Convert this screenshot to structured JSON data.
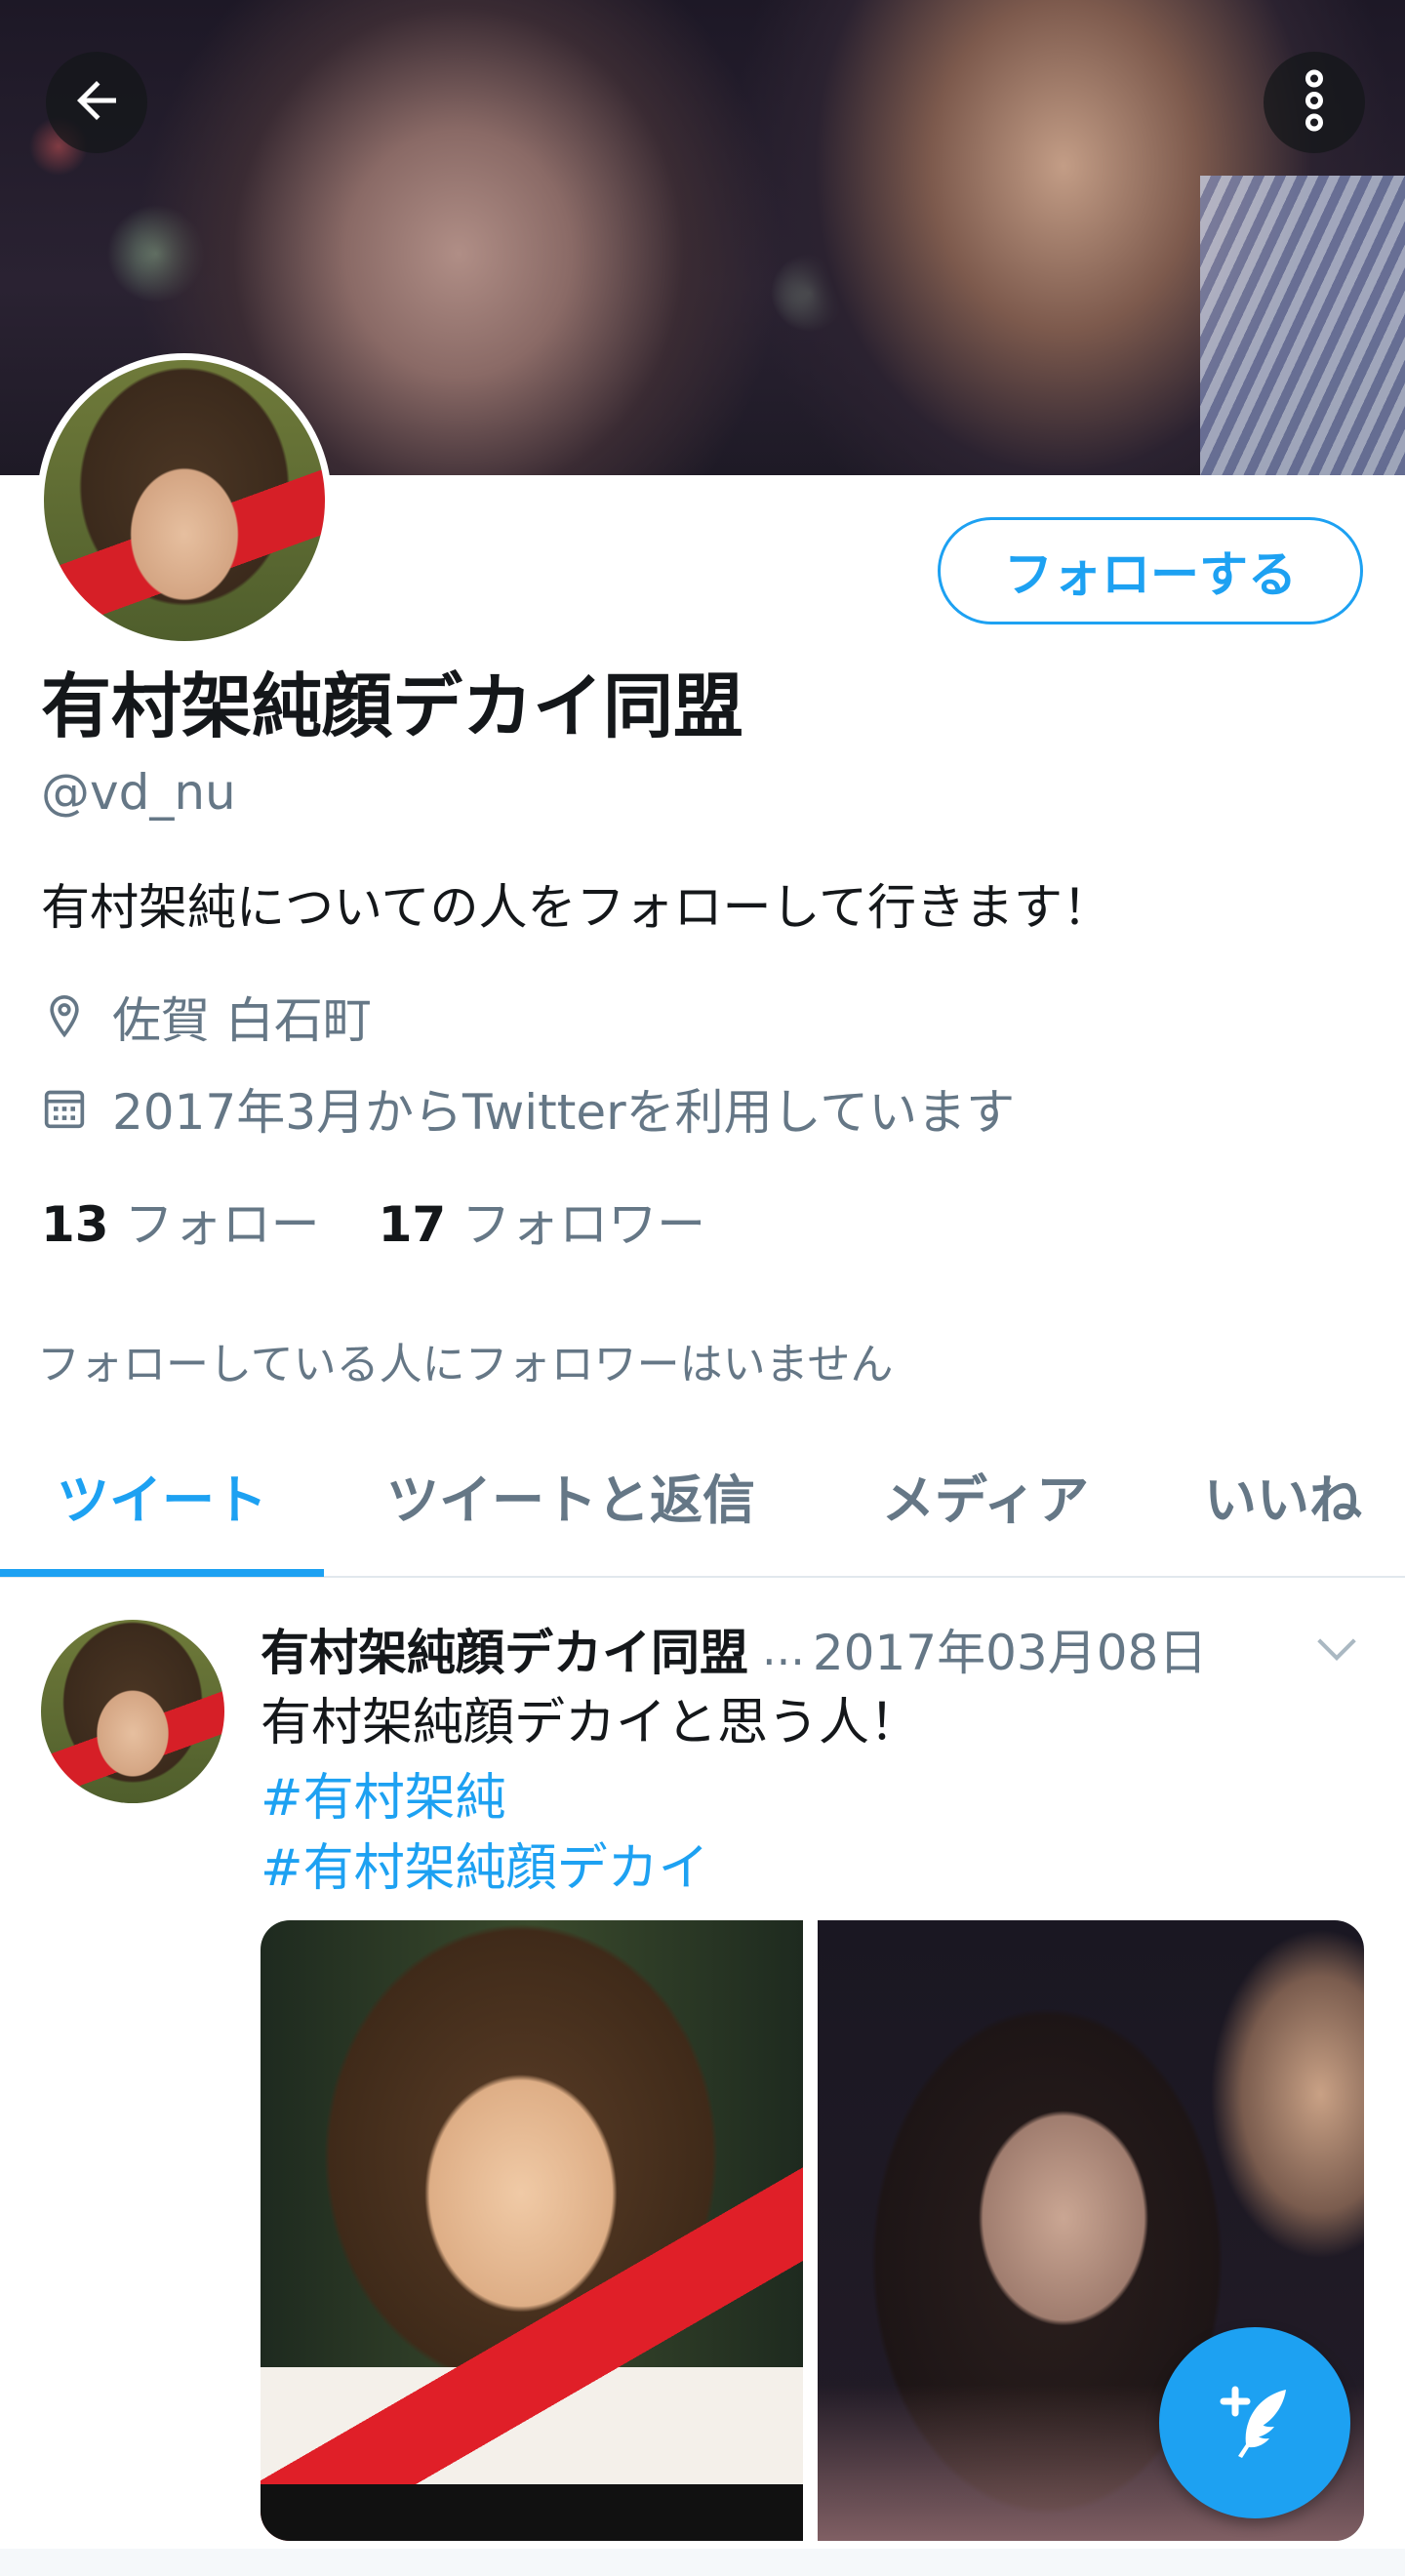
{
  "header": {
    "back_icon": "arrow-left-icon",
    "more_icon": "more-vertical-icon"
  },
  "profile": {
    "follow_label": "フォローする",
    "display_name": "有村架純顔デカイ同盟",
    "handle": "@vd_nu",
    "bio": "有村架純についての人をフォローして行きます！",
    "location": "佐賀 白石町",
    "location_icon": "location-pin-icon",
    "joined": "2017年3月からTwitterを利用しています",
    "joined_icon": "calendar-icon",
    "following_count": "13",
    "following_label": "フォロー",
    "followers_count": "17",
    "followers_label": "フォロワー",
    "followed_by_note": "フォローしている人にフォロワーはいません"
  },
  "tabs": [
    {
      "label": "ツイート",
      "active": true
    },
    {
      "label": "ツイートと返信",
      "active": false
    },
    {
      "label": "メディア",
      "active": false
    },
    {
      "label": "いいね",
      "active": false
    }
  ],
  "tweet": {
    "author": "有村架純顔デカイ同盟",
    "ellipsis": "...",
    "date": "2017年03月08日",
    "text": "有村架純顔デカイと思う人！",
    "hashtags": [
      "#有村架純",
      "#有村架純顔デカイ"
    ],
    "caret_icon": "chevron-down-icon",
    "media_count": 2
  },
  "fab": {
    "icon": "compose-tweet-icon"
  },
  "colors": {
    "accent": "#1da1f2",
    "text_primary": "#14171a",
    "text_secondary": "#657786"
  }
}
